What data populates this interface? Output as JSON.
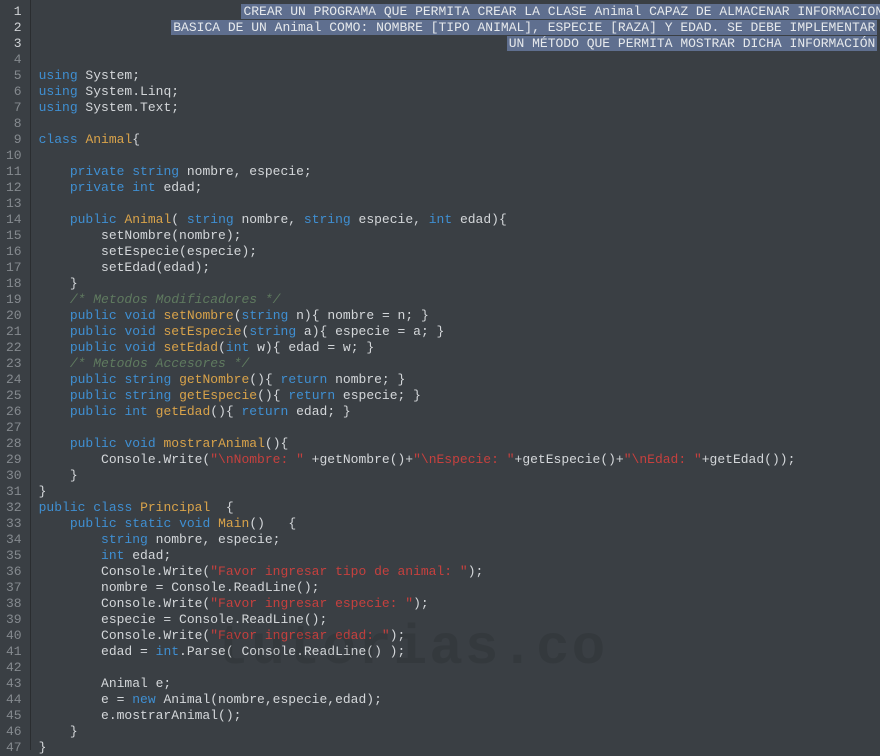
{
  "watermark": "tutorias.co",
  "gutter": [
    {
      "n": "1",
      "sel": true
    },
    {
      "n": "2",
      "sel": true
    },
    {
      "n": "3",
      "sel": true
    },
    {
      "n": "4"
    },
    {
      "n": "5"
    },
    {
      "n": "6"
    },
    {
      "n": "7"
    },
    {
      "n": "8"
    },
    {
      "n": "9"
    },
    {
      "n": "10"
    },
    {
      "n": "11"
    },
    {
      "n": "12"
    },
    {
      "n": "13"
    },
    {
      "n": "14"
    },
    {
      "n": "15"
    },
    {
      "n": "16"
    },
    {
      "n": "17"
    },
    {
      "n": "18"
    },
    {
      "n": "19"
    },
    {
      "n": "20"
    },
    {
      "n": "21"
    },
    {
      "n": "22"
    },
    {
      "n": "23"
    },
    {
      "n": "24"
    },
    {
      "n": "25"
    },
    {
      "n": "26"
    },
    {
      "n": "27"
    },
    {
      "n": "28"
    },
    {
      "n": "29"
    },
    {
      "n": "30"
    },
    {
      "n": "31"
    },
    {
      "n": "32"
    },
    {
      "n": "33"
    },
    {
      "n": "34"
    },
    {
      "n": "35"
    },
    {
      "n": "36"
    },
    {
      "n": "37"
    },
    {
      "n": "38"
    },
    {
      "n": "39"
    },
    {
      "n": "40"
    },
    {
      "n": "41"
    },
    {
      "n": "42"
    },
    {
      "n": "43"
    },
    {
      "n": "44"
    },
    {
      "n": "45"
    },
    {
      "n": "46"
    },
    {
      "n": "47"
    }
  ],
  "lines": [
    [
      {
        "cls": "",
        "txt": "                          "
      },
      {
        "cls": "sel-bg",
        "txt": "CREAR UN PROGRAMA QUE PERMITA CREAR LA CLASE Animal CAPAZ DE ALMACENAR INFORMACION"
      }
    ],
    [
      {
        "cls": "",
        "txt": "                 "
      },
      {
        "cls": "sel-bg",
        "txt": "BASICA DE UN Animal COMO: NOMBRE [TIPO ANIMAL], ESPECIE [RAZA] Y EDAD. SE DEBE IMPLEMENTAR"
      }
    ],
    [
      {
        "cls": "",
        "txt": "                                                            "
      },
      {
        "cls": "sel-bg",
        "txt": "UN MÉTODO QUE PERMITA MOSTRAR DICHA INFORMACIÓN"
      }
    ],
    [
      {
        "cls": "",
        "txt": ""
      }
    ],
    [
      {
        "cls": "kw",
        "txt": "using"
      },
      {
        "cls": "",
        "txt": " System;"
      }
    ],
    [
      {
        "cls": "kw",
        "txt": "using"
      },
      {
        "cls": "",
        "txt": " System.Linq;"
      }
    ],
    [
      {
        "cls": "kw",
        "txt": "using"
      },
      {
        "cls": "",
        "txt": " System.Text;"
      }
    ],
    [
      {
        "cls": "",
        "txt": ""
      }
    ],
    [
      {
        "cls": "kw",
        "txt": "class"
      },
      {
        "cls": "",
        "txt": " "
      },
      {
        "cls": "cls",
        "txt": "Animal"
      },
      {
        "cls": "",
        "txt": "{"
      }
    ],
    [
      {
        "cls": "",
        "txt": ""
      }
    ],
    [
      {
        "cls": "",
        "txt": "    "
      },
      {
        "cls": "kw",
        "txt": "private"
      },
      {
        "cls": "",
        "txt": " "
      },
      {
        "cls": "ty",
        "txt": "string"
      },
      {
        "cls": "",
        "txt": " nombre, especie;"
      }
    ],
    [
      {
        "cls": "",
        "txt": "    "
      },
      {
        "cls": "kw",
        "txt": "private"
      },
      {
        "cls": "",
        "txt": " "
      },
      {
        "cls": "ty",
        "txt": "int"
      },
      {
        "cls": "",
        "txt": " edad;"
      }
    ],
    [
      {
        "cls": "",
        "txt": ""
      }
    ],
    [
      {
        "cls": "",
        "txt": "    "
      },
      {
        "cls": "kw",
        "txt": "public"
      },
      {
        "cls": "",
        "txt": " "
      },
      {
        "cls": "fn",
        "txt": "Animal"
      },
      {
        "cls": "",
        "txt": "( "
      },
      {
        "cls": "ty",
        "txt": "string"
      },
      {
        "cls": "",
        "txt": " nombre, "
      },
      {
        "cls": "ty",
        "txt": "string"
      },
      {
        "cls": "",
        "txt": " especie, "
      },
      {
        "cls": "ty",
        "txt": "int"
      },
      {
        "cls": "",
        "txt": " edad){"
      }
    ],
    [
      {
        "cls": "",
        "txt": "        setNombre(nombre);"
      }
    ],
    [
      {
        "cls": "",
        "txt": "        setEspecie(especie);"
      }
    ],
    [
      {
        "cls": "",
        "txt": "        setEdad(edad);"
      }
    ],
    [
      {
        "cls": "",
        "txt": "    }"
      }
    ],
    [
      {
        "cls": "",
        "txt": "    "
      },
      {
        "cls": "cmt",
        "txt": "/* Metodos Modificadores */"
      }
    ],
    [
      {
        "cls": "",
        "txt": "    "
      },
      {
        "cls": "kw",
        "txt": "public"
      },
      {
        "cls": "",
        "txt": " "
      },
      {
        "cls": "ty",
        "txt": "void"
      },
      {
        "cls": "",
        "txt": " "
      },
      {
        "cls": "fn",
        "txt": "setNombre"
      },
      {
        "cls": "",
        "txt": "("
      },
      {
        "cls": "ty",
        "txt": "string"
      },
      {
        "cls": "",
        "txt": " n){ nombre = n; }"
      }
    ],
    [
      {
        "cls": "",
        "txt": "    "
      },
      {
        "cls": "kw",
        "txt": "public"
      },
      {
        "cls": "",
        "txt": " "
      },
      {
        "cls": "ty",
        "txt": "void"
      },
      {
        "cls": "",
        "txt": " "
      },
      {
        "cls": "fn",
        "txt": "setEspecie"
      },
      {
        "cls": "",
        "txt": "("
      },
      {
        "cls": "ty",
        "txt": "string"
      },
      {
        "cls": "",
        "txt": " a){ especie = a; }"
      }
    ],
    [
      {
        "cls": "",
        "txt": "    "
      },
      {
        "cls": "kw",
        "txt": "public"
      },
      {
        "cls": "",
        "txt": " "
      },
      {
        "cls": "ty",
        "txt": "void"
      },
      {
        "cls": "",
        "txt": " "
      },
      {
        "cls": "fn",
        "txt": "setEdad"
      },
      {
        "cls": "",
        "txt": "("
      },
      {
        "cls": "ty",
        "txt": "int"
      },
      {
        "cls": "",
        "txt": " w){ edad = w; }"
      }
    ],
    [
      {
        "cls": "",
        "txt": "    "
      },
      {
        "cls": "cmt",
        "txt": "/* Metodos Accesores */"
      }
    ],
    [
      {
        "cls": "",
        "txt": "    "
      },
      {
        "cls": "kw",
        "txt": "public"
      },
      {
        "cls": "",
        "txt": " "
      },
      {
        "cls": "ty",
        "txt": "string"
      },
      {
        "cls": "",
        "txt": " "
      },
      {
        "cls": "fn",
        "txt": "getNombre"
      },
      {
        "cls": "",
        "txt": "(){ "
      },
      {
        "cls": "kw",
        "txt": "return"
      },
      {
        "cls": "",
        "txt": " nombre; }"
      }
    ],
    [
      {
        "cls": "",
        "txt": "    "
      },
      {
        "cls": "kw",
        "txt": "public"
      },
      {
        "cls": "",
        "txt": " "
      },
      {
        "cls": "ty",
        "txt": "string"
      },
      {
        "cls": "",
        "txt": " "
      },
      {
        "cls": "fn",
        "txt": "getEspecie"
      },
      {
        "cls": "",
        "txt": "(){ "
      },
      {
        "cls": "kw",
        "txt": "return"
      },
      {
        "cls": "",
        "txt": " especie; }"
      }
    ],
    [
      {
        "cls": "",
        "txt": "    "
      },
      {
        "cls": "kw",
        "txt": "public"
      },
      {
        "cls": "",
        "txt": " "
      },
      {
        "cls": "ty",
        "txt": "int"
      },
      {
        "cls": "",
        "txt": " "
      },
      {
        "cls": "fn",
        "txt": "getEdad"
      },
      {
        "cls": "",
        "txt": "(){ "
      },
      {
        "cls": "kw",
        "txt": "return"
      },
      {
        "cls": "",
        "txt": " edad; }"
      }
    ],
    [
      {
        "cls": "",
        "txt": ""
      }
    ],
    [
      {
        "cls": "",
        "txt": "    "
      },
      {
        "cls": "kw",
        "txt": "public"
      },
      {
        "cls": "",
        "txt": " "
      },
      {
        "cls": "ty",
        "txt": "void"
      },
      {
        "cls": "",
        "txt": " "
      },
      {
        "cls": "fn",
        "txt": "mostrarAnimal"
      },
      {
        "cls": "",
        "txt": "(){"
      }
    ],
    [
      {
        "cls": "",
        "txt": "        Console.Write("
      },
      {
        "cls": "str",
        "txt": "\"\\nNombre: \""
      },
      {
        "cls": "",
        "txt": " +getNombre()+"
      },
      {
        "cls": "str",
        "txt": "\"\\nEspecie: \""
      },
      {
        "cls": "",
        "txt": "+getEspecie()+"
      },
      {
        "cls": "str",
        "txt": "\"\\nEdad: \""
      },
      {
        "cls": "",
        "txt": "+getEdad());"
      }
    ],
    [
      {
        "cls": "",
        "txt": "    }"
      }
    ],
    [
      {
        "cls": "",
        "txt": "}"
      }
    ],
    [
      {
        "cls": "kw",
        "txt": "public"
      },
      {
        "cls": "",
        "txt": " "
      },
      {
        "cls": "kw",
        "txt": "class"
      },
      {
        "cls": "",
        "txt": " "
      },
      {
        "cls": "cls",
        "txt": "Principal"
      },
      {
        "cls": "",
        "txt": "  {"
      }
    ],
    [
      {
        "cls": "",
        "txt": "    "
      },
      {
        "cls": "kw",
        "txt": "public"
      },
      {
        "cls": "",
        "txt": " "
      },
      {
        "cls": "kw",
        "txt": "static"
      },
      {
        "cls": "",
        "txt": " "
      },
      {
        "cls": "ty",
        "txt": "void"
      },
      {
        "cls": "",
        "txt": " "
      },
      {
        "cls": "fn",
        "txt": "Main"
      },
      {
        "cls": "",
        "txt": "()   {"
      }
    ],
    [
      {
        "cls": "",
        "txt": "        "
      },
      {
        "cls": "ty",
        "txt": "string"
      },
      {
        "cls": "",
        "txt": " nombre, especie;"
      }
    ],
    [
      {
        "cls": "",
        "txt": "        "
      },
      {
        "cls": "ty",
        "txt": "int"
      },
      {
        "cls": "",
        "txt": " edad;"
      }
    ],
    [
      {
        "cls": "",
        "txt": "        Console.Write("
      },
      {
        "cls": "str",
        "txt": "\"Favor ingresar tipo de animal: \""
      },
      {
        "cls": "",
        "txt": ");"
      }
    ],
    [
      {
        "cls": "",
        "txt": "        nombre = Console.ReadLine();"
      }
    ],
    [
      {
        "cls": "",
        "txt": "        Console.Write("
      },
      {
        "cls": "str",
        "txt": "\"Favor ingresar especie: \""
      },
      {
        "cls": "",
        "txt": ");"
      }
    ],
    [
      {
        "cls": "",
        "txt": "        especie = Console.ReadLine();"
      }
    ],
    [
      {
        "cls": "",
        "txt": "        Console.Write("
      },
      {
        "cls": "str",
        "txt": "\"Favor ingresar edad: \""
      },
      {
        "cls": "",
        "txt": ");"
      }
    ],
    [
      {
        "cls": "",
        "txt": "        edad = "
      },
      {
        "cls": "ty",
        "txt": "int"
      },
      {
        "cls": "",
        "txt": ".Parse( Console.ReadLine() );"
      }
    ],
    [
      {
        "cls": "",
        "txt": ""
      }
    ],
    [
      {
        "cls": "",
        "txt": "        Animal e;"
      }
    ],
    [
      {
        "cls": "",
        "txt": "        e = "
      },
      {
        "cls": "kw",
        "txt": "new"
      },
      {
        "cls": "",
        "txt": " Animal(nombre,especie,edad);"
      }
    ],
    [
      {
        "cls": "",
        "txt": "        e.mostrarAnimal();"
      }
    ],
    [
      {
        "cls": "",
        "txt": "    }"
      }
    ],
    [
      {
        "cls": "",
        "txt": "}"
      }
    ]
  ]
}
